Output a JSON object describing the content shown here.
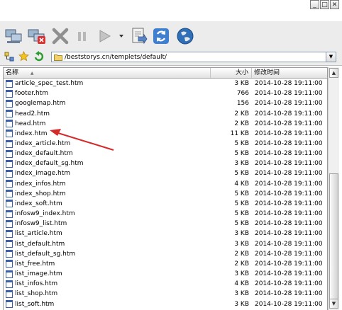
{
  "window": {
    "restore_glyph": "□",
    "close_glyph": "✕"
  },
  "toolbar": {
    "icons": [
      "connect-icon",
      "disconnect-icon",
      "abort-icon",
      "pause-icon",
      "play-icon",
      "dropdown-icon",
      "transfer-icon",
      "refresh-icon",
      "globe-icon"
    ]
  },
  "address": {
    "path": "/beststorys.cn/templets/default/"
  },
  "columns": {
    "name": "名称",
    "size": "大小",
    "date": "修改时间"
  },
  "files": [
    {
      "name": "article_spec_test.htm",
      "size": "3 KB",
      "date": "2014-10-28 19:11:00"
    },
    {
      "name": "footer.htm",
      "size": "766",
      "date": "2014-10-28 19:11:00"
    },
    {
      "name": "googlemap.htm",
      "size": "156",
      "date": "2014-10-28 19:11:00"
    },
    {
      "name": "head2.htm",
      "size": "2 KB",
      "date": "2014-10-28 19:11:00"
    },
    {
      "name": "head.htm",
      "size": "2 KB",
      "date": "2014-10-28 19:11:00"
    },
    {
      "name": "index.htm",
      "size": "11 KB",
      "date": "2014-10-28 19:11:00"
    },
    {
      "name": "index_article.htm",
      "size": "5 KB",
      "date": "2014-10-28 19:11:00"
    },
    {
      "name": "index_default.htm",
      "size": "5 KB",
      "date": "2014-10-28 19:11:00"
    },
    {
      "name": "index_default_sg.htm",
      "size": "3 KB",
      "date": "2014-10-28 19:11:00"
    },
    {
      "name": "index_image.htm",
      "size": "5 KB",
      "date": "2014-10-28 19:11:00"
    },
    {
      "name": "index_infos.htm",
      "size": "4 KB",
      "date": "2014-10-28 19:11:00"
    },
    {
      "name": "index_shop.htm",
      "size": "5 KB",
      "date": "2014-10-28 19:11:00"
    },
    {
      "name": "index_soft.htm",
      "size": "5 KB",
      "date": "2014-10-28 19:11:00"
    },
    {
      "name": "infosw9_index.htm",
      "size": "5 KB",
      "date": "2014-10-28 19:11:00"
    },
    {
      "name": "infosw9_list.htm",
      "size": "5 KB",
      "date": "2014-10-28 19:11:00"
    },
    {
      "name": "list_article.htm",
      "size": "3 KB",
      "date": "2014-10-28 19:11:00"
    },
    {
      "name": "list_default.htm",
      "size": "3 KB",
      "date": "2014-10-28 19:11:00"
    },
    {
      "name": "list_default_sg.htm",
      "size": "2 KB",
      "date": "2014-10-28 19:11:00"
    },
    {
      "name": "list_free.htm",
      "size": "2 KB",
      "date": "2014-10-28 19:11:00"
    },
    {
      "name": "list_image.htm",
      "size": "3 KB",
      "date": "2014-10-28 19:11:00"
    },
    {
      "name": "list_infos.htm",
      "size": "4 KB",
      "date": "2014-10-28 19:11:00"
    },
    {
      "name": "list_shop.htm",
      "size": "3 KB",
      "date": "2014-10-28 19:11:00"
    },
    {
      "name": "list_soft.htm",
      "size": "3 KB",
      "date": "2014-10-28 19:11:00"
    }
  ],
  "colors": {
    "accent_arrow": "#d42a2a",
    "file_icon_border": "#3a5fa8",
    "toolbar_bg": "#ececec"
  }
}
